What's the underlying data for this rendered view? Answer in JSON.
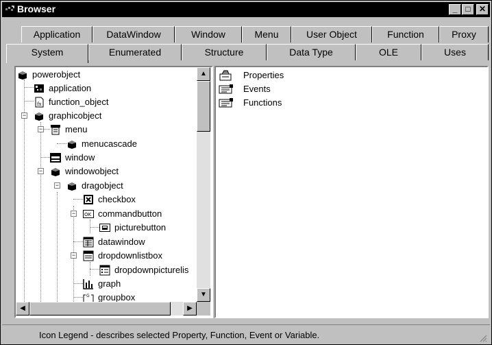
{
  "window": {
    "title": "Browser"
  },
  "titlebar_buttons": {
    "minimize": "_",
    "maximize": "□",
    "close": "✕"
  },
  "tabs_row1": [
    "Application",
    "DataWindow",
    "Window",
    "Menu",
    "User Object",
    "Function",
    "Proxy"
  ],
  "tabs_row2": [
    "System",
    "Enumerated",
    "Structure",
    "Data Type",
    "OLE",
    "Uses"
  ],
  "selected_tab": "System",
  "tree": [
    {
      "label": "powerobject",
      "icon": "cube-icon"
    },
    {
      "label": "application",
      "icon": "application-icon"
    },
    {
      "label": "function_object",
      "icon": "function-icon"
    },
    {
      "label": "graphicobject",
      "icon": "cube-icon"
    },
    {
      "label": "menu",
      "icon": "menu-icon"
    },
    {
      "label": "menucascade",
      "icon": "cube-icon"
    },
    {
      "label": "window",
      "icon": "window-icon"
    },
    {
      "label": "windowobject",
      "icon": "cube-icon"
    },
    {
      "label": "dragobject",
      "icon": "cube-icon"
    },
    {
      "label": "checkbox",
      "icon": "checkbox-icon"
    },
    {
      "label": "commandbutton",
      "icon": "commandbutton-icon"
    },
    {
      "label": "picturebutton",
      "icon": "picturebutton-icon"
    },
    {
      "label": "datawindow",
      "icon": "datawindow-icon"
    },
    {
      "label": "dropdownlistbox",
      "icon": "dropdownlistbox-icon"
    },
    {
      "label": "dropdownpicturelis",
      "icon": "dropdownpicturelistbox-icon"
    },
    {
      "label": "graph",
      "icon": "graph-icon"
    },
    {
      "label": "groupbox",
      "icon": "groupbox-icon"
    }
  ],
  "commandbutton_icon_text": "OK",
  "groupbox_icon_text": "G",
  "right_items": [
    {
      "label": "Properties",
      "icon": "properties-icon"
    },
    {
      "label": "Events",
      "icon": "events-icon"
    },
    {
      "label": "Functions",
      "icon": "functions-icon"
    }
  ],
  "status_text": "Icon Legend - describes selected Property, Function, Event or Variable."
}
